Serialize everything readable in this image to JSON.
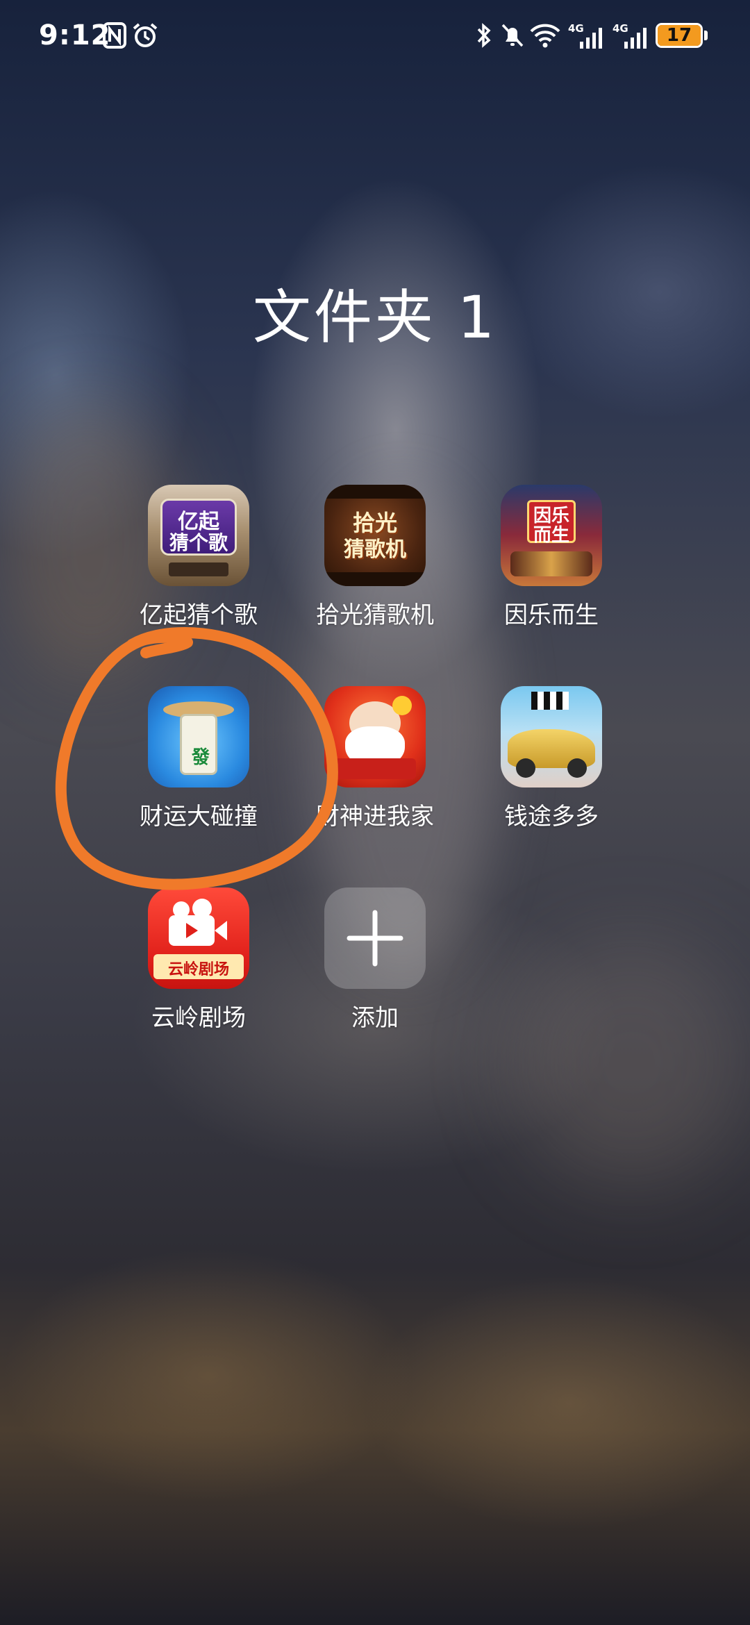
{
  "status_bar": {
    "time": "9:12",
    "battery_level": "17",
    "battery_color": "#f39a1f",
    "network_labels": [
      "4G",
      "4G"
    ],
    "icons": [
      "nfc-icon",
      "alarm-icon",
      "bluetooth-icon",
      "mute-icon",
      "wifi-icon",
      "signal-icon",
      "signal-icon",
      "battery-icon"
    ]
  },
  "folder": {
    "title": "文件夹 1",
    "apps": [
      {
        "label": "亿起猜个歌",
        "icon_text": [
          "亿起",
          "猜个歌"
        ]
      },
      {
        "label": "拾光猜歌机",
        "icon_text": [
          "拾光",
          "猜歌机"
        ]
      },
      {
        "label": "因乐而生",
        "icon_text": [
          "因乐",
          "而生"
        ]
      },
      {
        "label": "财运大碰撞",
        "icon_text": [
          "發"
        ]
      },
      {
        "label": "财神进我家",
        "icon_text": []
      },
      {
        "label": "钱途多多",
        "icon_text": []
      },
      {
        "label": "云岭剧场",
        "icon_text": [
          "云岭剧场"
        ]
      }
    ],
    "add_label": "添加"
  },
  "annotation": {
    "color": "#f07a2a"
  }
}
